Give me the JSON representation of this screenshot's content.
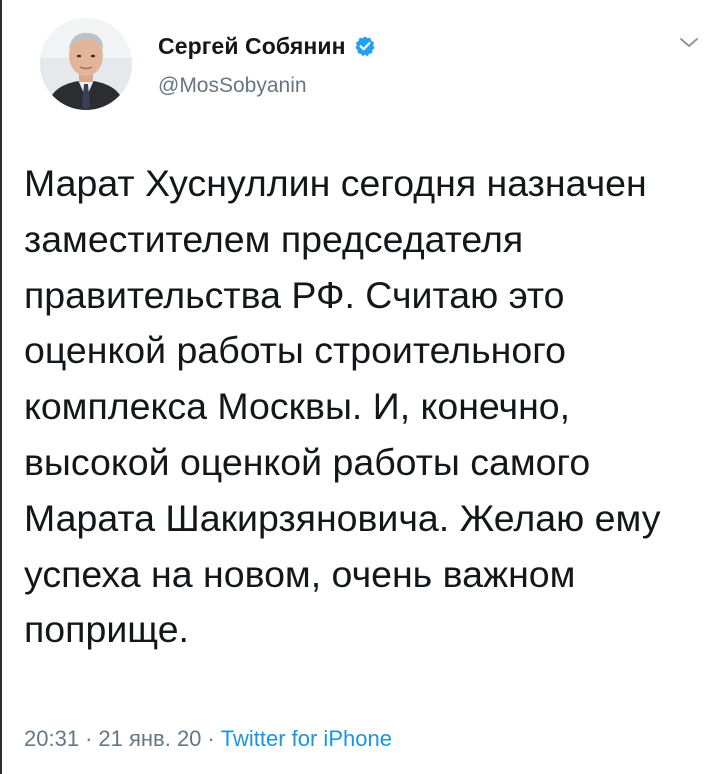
{
  "author": {
    "display_name": "Сергей Собянин",
    "handle": "@MosSobyanin",
    "verified": true,
    "avatar_icon": "user-avatar",
    "verified_icon": "verified-badge-icon"
  },
  "tweet": {
    "text": "Марат Хуснуллин сегодня назначен заместителем председателя правительства РФ. Считаю это оценкой работы строительного комплекса Москвы. И, конечно, высокой оценкой работы самого Марата Шакирзяновича. Желаю ему успеха на новом, очень важном поприще.",
    "time": "20:31",
    "date": "21 янв. 20",
    "separator": "·",
    "source": "Twitter for iPhone"
  },
  "colors": {
    "text": "#14171a",
    "secondary": "#657786",
    "accent": "#1b95e0",
    "verified": "#1da1f2"
  },
  "menu": {
    "caret_icon": "chevron-down-icon"
  }
}
